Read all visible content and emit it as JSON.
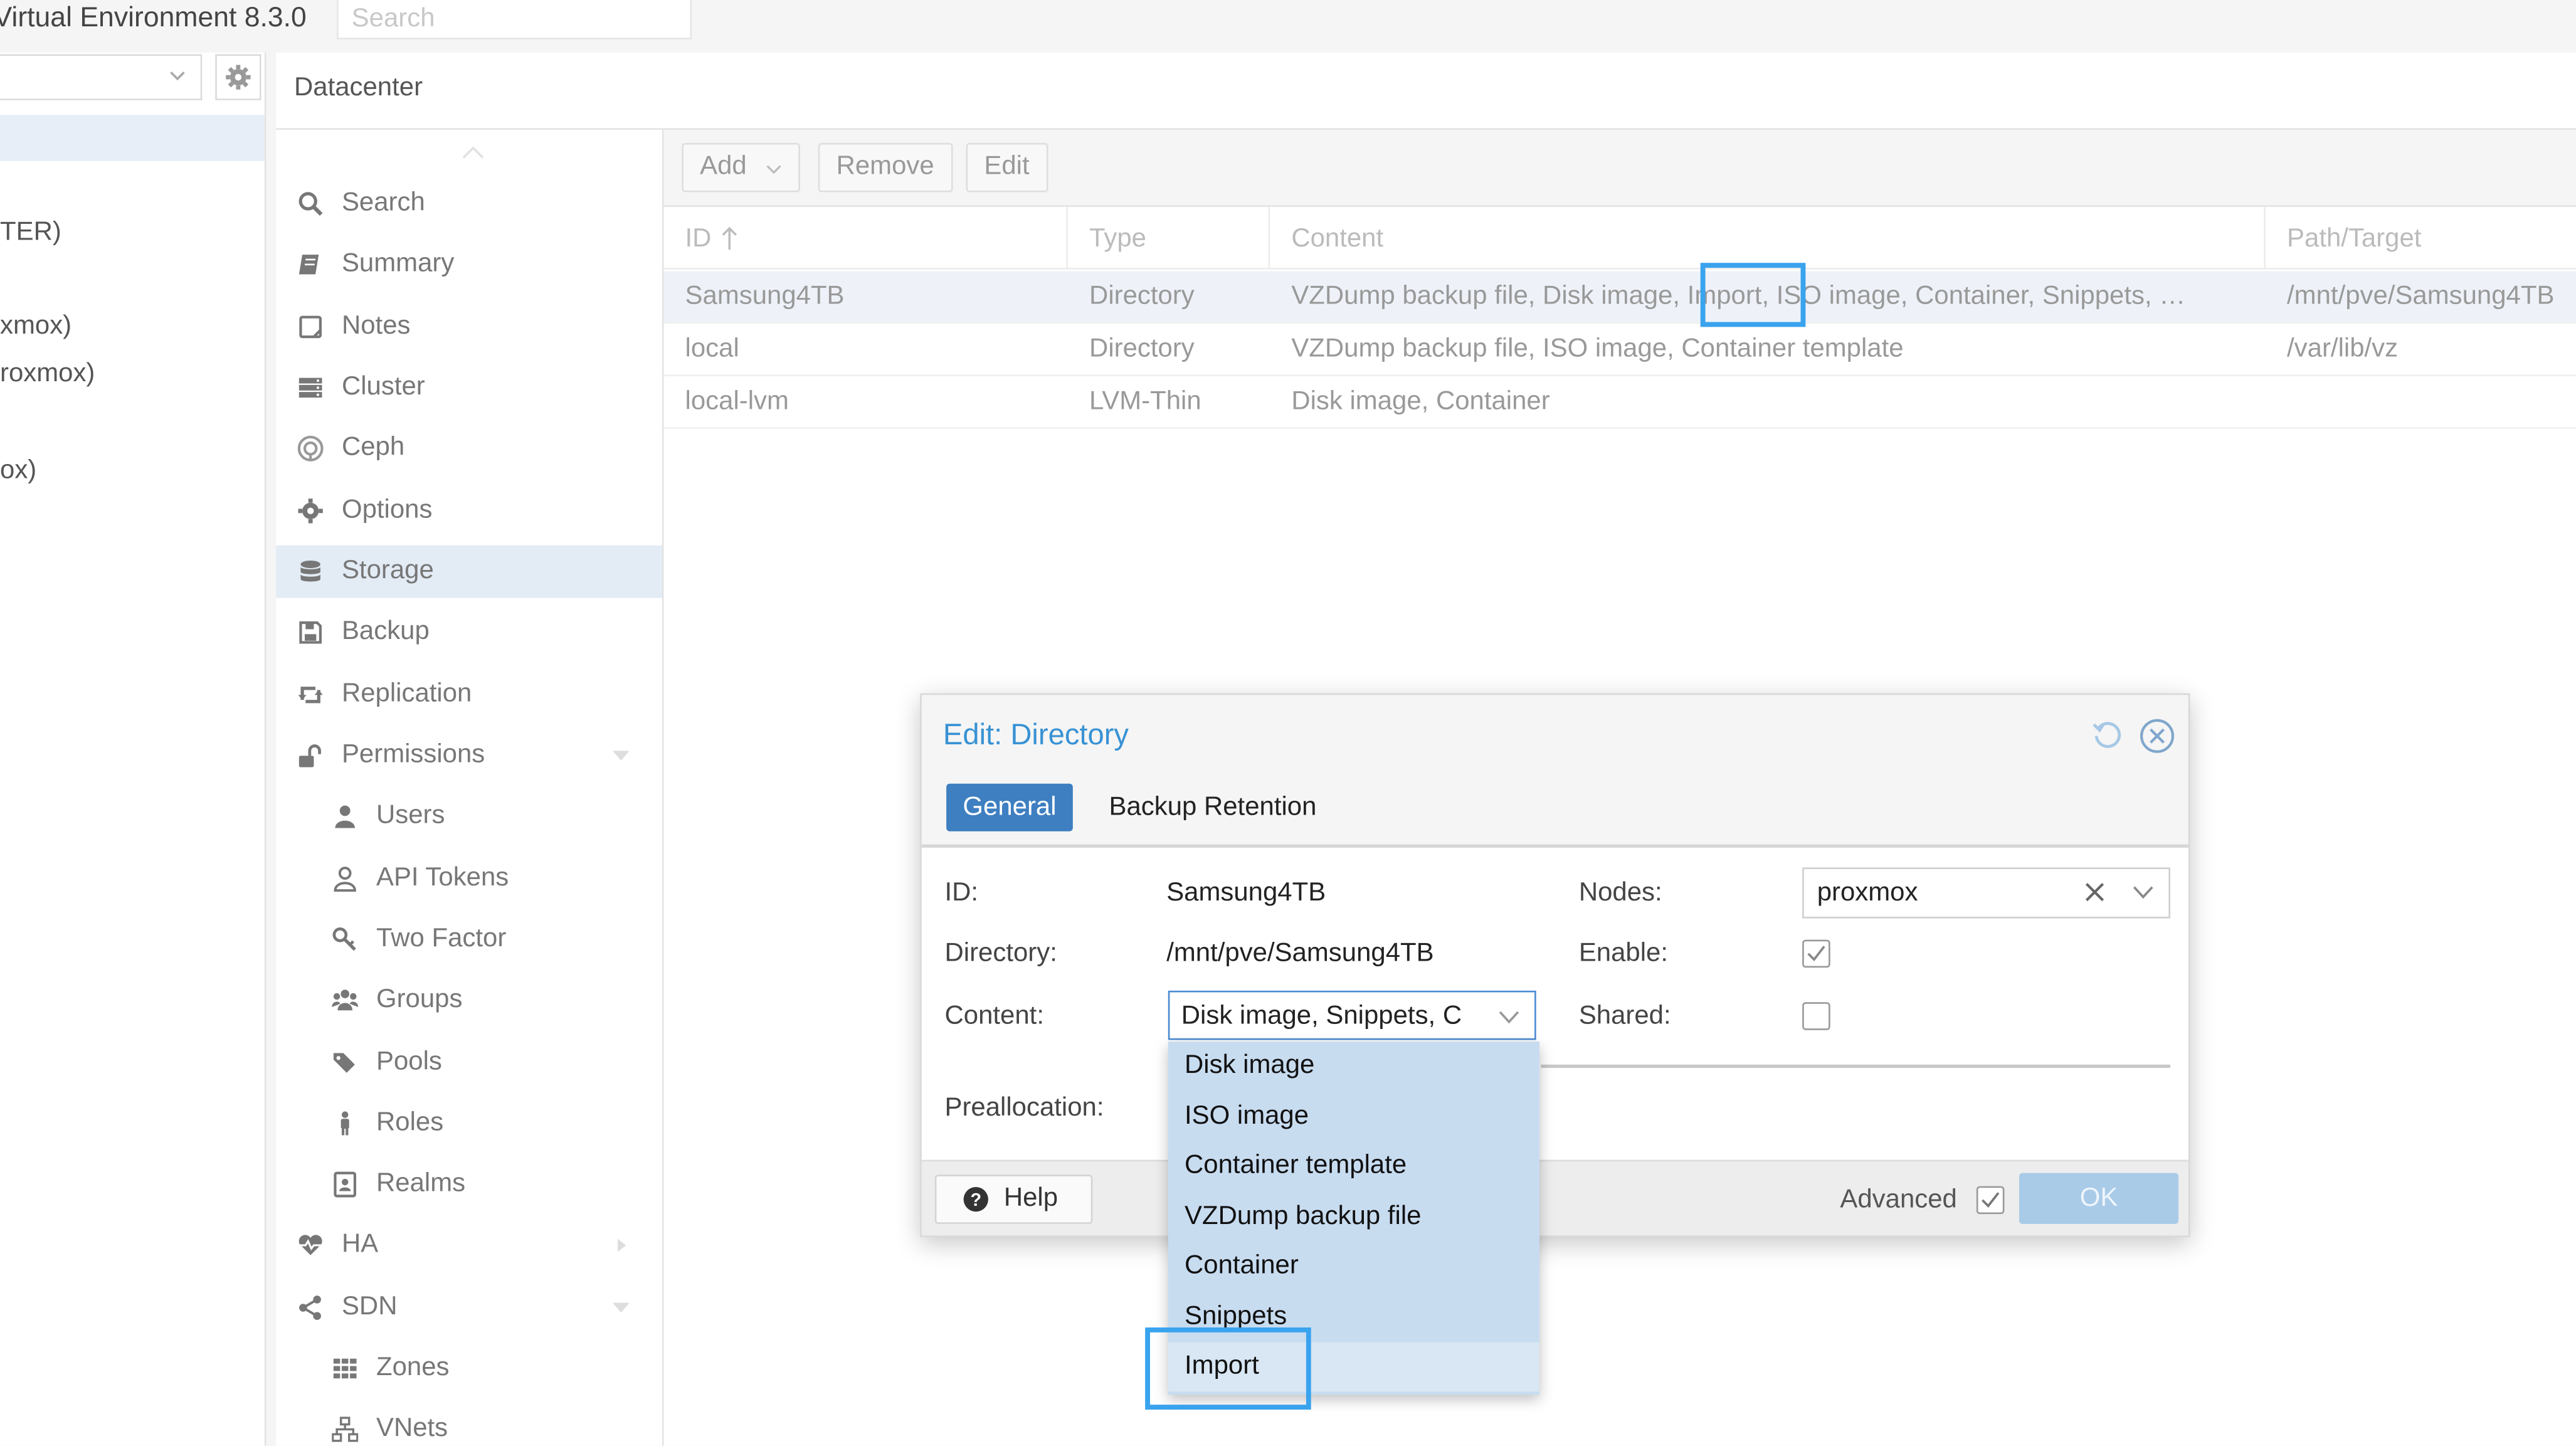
{
  "topbar": {
    "app_title": "Virtual Environment 8.3.0",
    "search_placeholder": "Search"
  },
  "tree": {
    "items": [
      "TER)",
      "xmox)",
      "roxmox)",
      "ox)"
    ]
  },
  "header": {
    "title": "Datacenter"
  },
  "menu": {
    "items": [
      {
        "label": "Search",
        "icon": "search-icon"
      },
      {
        "label": "Summary",
        "icon": "book-icon"
      },
      {
        "label": "Notes",
        "icon": "note-icon"
      },
      {
        "label": "Cluster",
        "icon": "server-icon"
      },
      {
        "label": "Ceph",
        "icon": "ceph-icon"
      },
      {
        "label": "Options",
        "icon": "gear-icon"
      },
      {
        "label": "Storage",
        "icon": "database-icon",
        "active": true
      },
      {
        "label": "Backup",
        "icon": "floppy-icon"
      },
      {
        "label": "Replication",
        "icon": "retweet-icon"
      },
      {
        "label": "Permissions",
        "icon": "unlock-icon"
      },
      {
        "label": "Users",
        "icon": "user-icon"
      },
      {
        "label": "API Tokens",
        "icon": "user-outline-icon"
      },
      {
        "label": "Two Factor",
        "icon": "key-icon"
      },
      {
        "label": "Groups",
        "icon": "users-icon"
      },
      {
        "label": "Pools",
        "icon": "tags-icon"
      },
      {
        "label": "Roles",
        "icon": "male-icon"
      },
      {
        "label": "Realms",
        "icon": "address-book-icon"
      },
      {
        "label": "HA",
        "icon": "heartbeat-icon"
      },
      {
        "label": "SDN",
        "icon": "share-alt-icon"
      },
      {
        "label": "Zones",
        "icon": "grid-icon"
      },
      {
        "label": "VNets",
        "icon": "sitemap-icon"
      }
    ]
  },
  "toolbar": {
    "add": "Add",
    "remove": "Remove",
    "edit": "Edit"
  },
  "grid": {
    "columns": [
      "ID",
      "Type",
      "Content",
      "Path/Target"
    ],
    "rows": [
      {
        "id": "Samsung4TB",
        "type": "Directory",
        "content": "VZDump backup file, Disk image, Import, ISO image, Container, Snippets, …",
        "path": "/mnt/pve/Samsung4TB"
      },
      {
        "id": "local",
        "type": "Directory",
        "content": "VZDump backup file, ISO image, Container template",
        "path": "/var/lib/vz"
      },
      {
        "id": "local-lvm",
        "type": "LVM-Thin",
        "content": "Disk image, Container",
        "path": ""
      }
    ]
  },
  "dialog": {
    "title": "Edit: Directory",
    "tabs": [
      "General",
      "Backup Retention"
    ],
    "fields": {
      "id_label": "ID:",
      "id_value": "Samsung4TB",
      "directory_label": "Directory:",
      "directory_value": "/mnt/pve/Samsung4TB",
      "content_label": "Content:",
      "content_value": "Disk image, Snippets, C",
      "nodes_label": "Nodes:",
      "nodes_value": "proxmox",
      "enable_label": "Enable:",
      "enable_checked": true,
      "shared_label": "Shared:",
      "shared_checked": false,
      "prealloc_label": "Preallocation:"
    },
    "footer": {
      "help": "Help",
      "advanced": "Advanced",
      "advanced_checked": true,
      "ok": "OK"
    }
  },
  "dropdown": {
    "options": [
      "Disk image",
      "ISO image",
      "Container template",
      "VZDump backup file",
      "Container",
      "Snippets",
      "Import"
    ]
  },
  "colors": {
    "accent": "#3892d4",
    "tab_active": "#3e7fc1",
    "highlight": "#3aa3ee"
  }
}
